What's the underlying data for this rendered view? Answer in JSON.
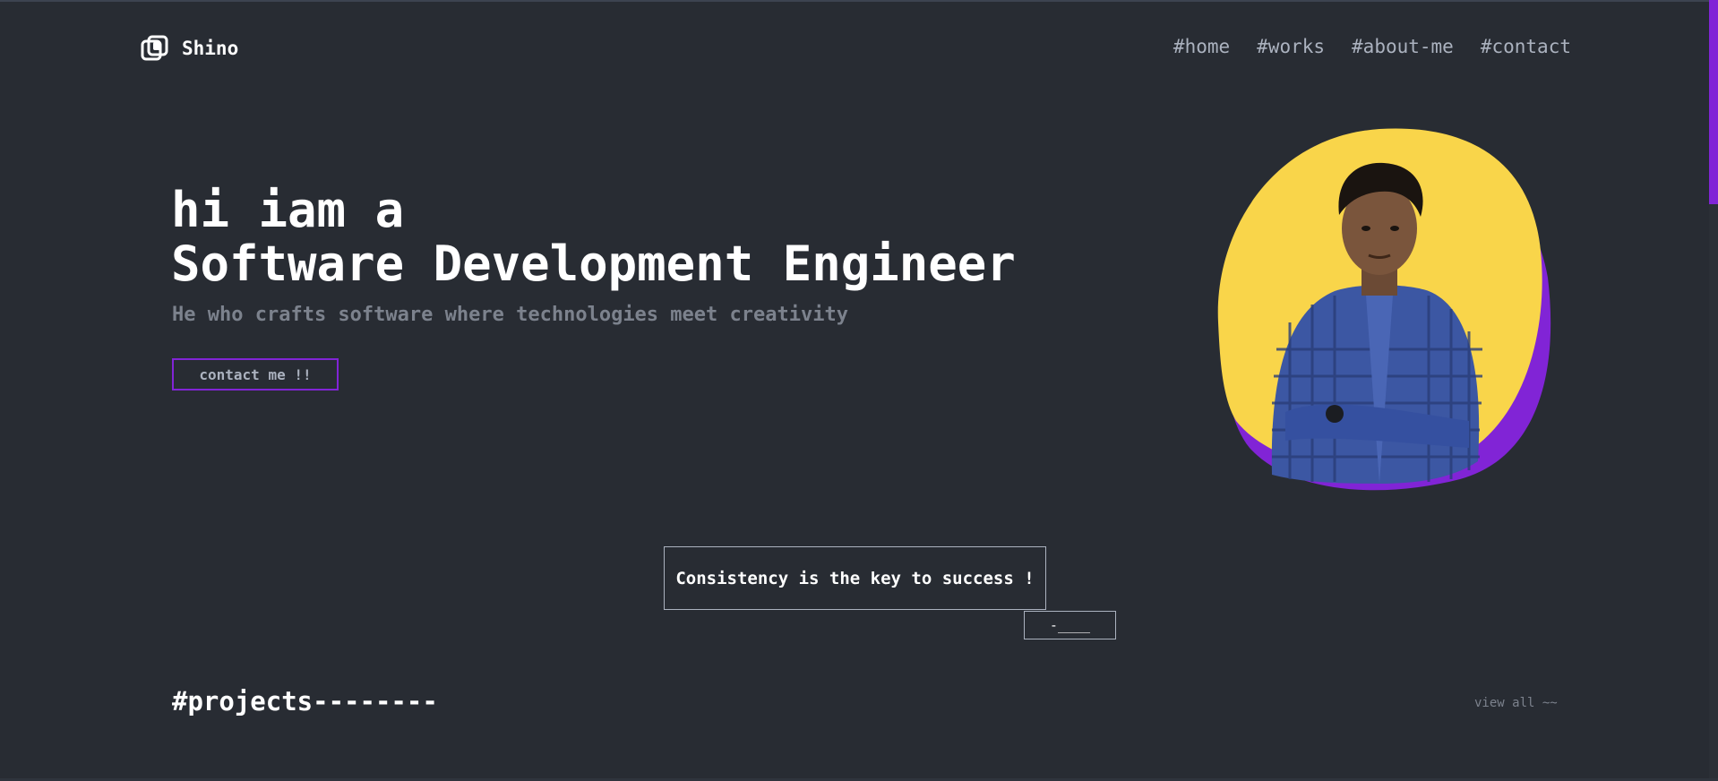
{
  "header": {
    "logo_name": "Shino",
    "nav": [
      {
        "hash": "#",
        "label": "home"
      },
      {
        "hash": "#",
        "label": "works"
      },
      {
        "hash": "#",
        "label": "about-me"
      },
      {
        "hash": "#",
        "label": "contact"
      }
    ]
  },
  "hero": {
    "line1": "hi iam a",
    "line2": "Software Development Engineer",
    "subtitle": "He who crafts software where technologies meet creativity",
    "button_label": "contact me !!"
  },
  "quote": {
    "text": "Consistency is the key to success !",
    "author": "-____"
  },
  "projects": {
    "title": "#projects--------",
    "view_all": "view all ~~"
  },
  "colors": {
    "background": "#282c33",
    "accent_purple": "#8124d6",
    "accent_yellow": "#f9d54a",
    "text_gray": "#abb2bf"
  }
}
